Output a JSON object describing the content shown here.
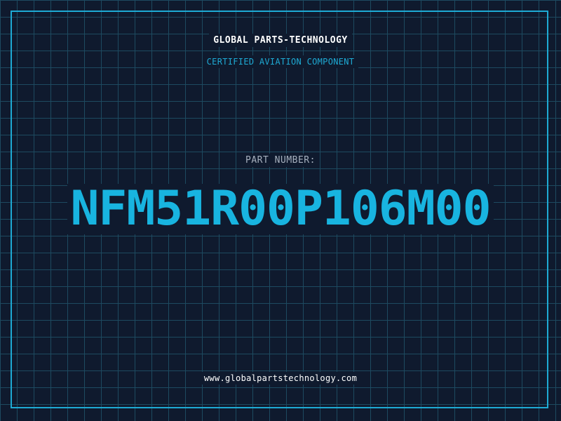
{
  "header": {
    "company": "GLOBAL PARTS-TECHNOLOGY",
    "subtitle": "CERTIFIED AVIATION COMPONENT"
  },
  "part": {
    "label": "PART NUMBER:",
    "number": "NFM51R00P106M00"
  },
  "footer": {
    "website": "www.globalpartstechnology.com"
  },
  "colors": {
    "background": "#0f1a2e",
    "grid": "#1d4a60",
    "accent": "#1eaad4",
    "part_number": "#18b4e0"
  }
}
